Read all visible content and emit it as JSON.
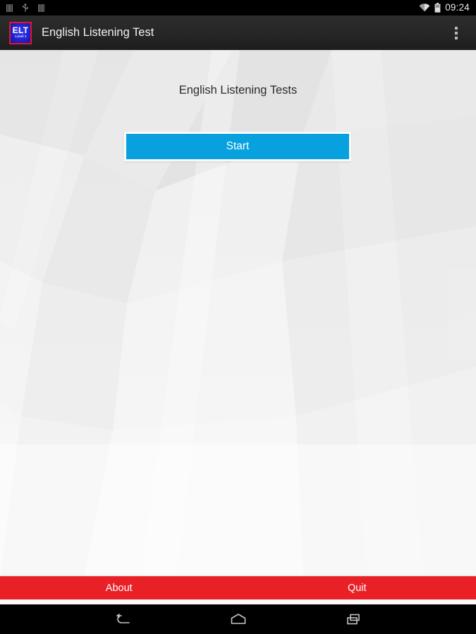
{
  "status_bar": {
    "icons_left": [
      "sim-card-icon",
      "usb-icon",
      "sim-card-icon"
    ],
    "icons_right": [
      "wifi-icon",
      "battery-icon"
    ],
    "clock": "09:24"
  },
  "action_bar": {
    "app_icon": {
      "name": "elt-app-icon",
      "primary_text": "ELT",
      "secondary_text": "Level 1",
      "border_color": "#e4152a",
      "fill_color": "#2222cf"
    },
    "title": "English Listening Test",
    "overflow_icon": "more-vertical-icon"
  },
  "main": {
    "headline": "English Listening Tests",
    "start_label": "Start",
    "accent_color": "#06a1de",
    "background_color": "#f2f2f2"
  },
  "bottom_bar": {
    "color": "#ea2027",
    "items": [
      {
        "label": "About",
        "name": "about-button"
      },
      {
        "label": "Quit",
        "name": "quit-button"
      }
    ]
  },
  "nav_bar": {
    "buttons": [
      "back-icon",
      "home-icon",
      "recents-icon"
    ]
  }
}
